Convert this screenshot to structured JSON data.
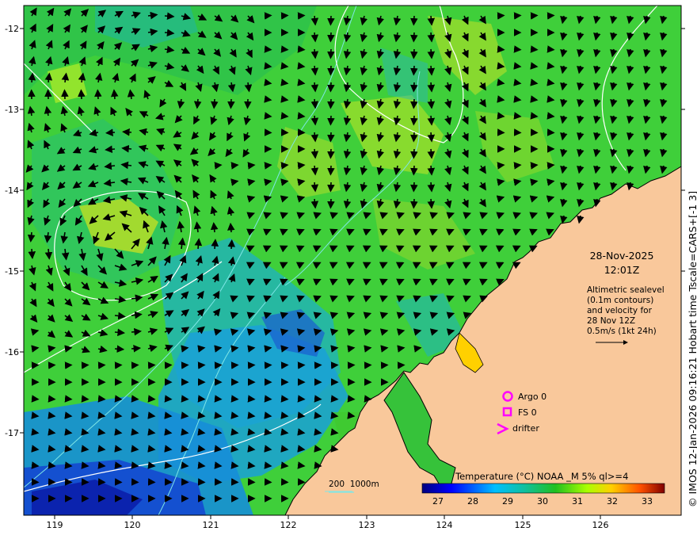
{
  "map": {
    "lon_ticks": [
      "119",
      "120",
      "121",
      "122",
      "123",
      "124",
      "125",
      "126"
    ],
    "lat_ticks": [
      "-12",
      "-13",
      "-14",
      "-15",
      "-16",
      "-17"
    ],
    "date": "28-Nov-2025",
    "time": "12:01Z",
    "altimetry_note": "Altimetric sealevel\n(0.1m contours)\nand velocity for\n28 Nov 12Z\n0.5m/s (1kt 24h)",
    "legend": {
      "argo": "Argo 0",
      "fs": "FS 0",
      "drifter": "drifter"
    },
    "depth_scale": {
      "a": "200",
      "b": "1000m"
    },
    "colorbar": {
      "title": "Temperature (°C) NOAA _M 5% ql>=4",
      "ticks": [
        "27",
        "28",
        "29",
        "30",
        "31",
        "32",
        "33"
      ]
    },
    "credit": "© IMOS 12-Jan-2026 09:16:21 Hobart time Tscale=CARS+[-1 3]",
    "colors": {
      "land": "#f9c89b",
      "marker": "#ff00ff",
      "contour": "#ffffff",
      "isobath": "#7fe6e6"
    }
  }
}
